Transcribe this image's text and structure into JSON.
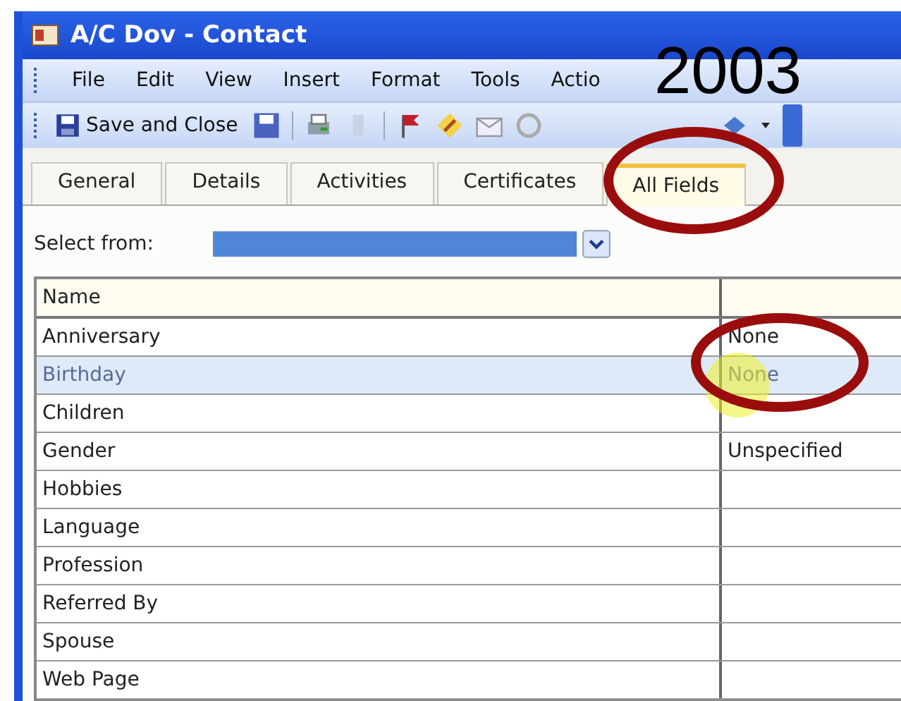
{
  "window": {
    "title": "A/C Dov - Contact"
  },
  "menu": [
    "File",
    "Edit",
    "View",
    "Insert",
    "Format",
    "Tools",
    "Actio"
  ],
  "toolbar": {
    "save_and_close": "Save and Close"
  },
  "tabs": [
    {
      "label": "General",
      "selected": false
    },
    {
      "label": "Details",
      "selected": false
    },
    {
      "label": "Activities",
      "selected": false
    },
    {
      "label": "Certificates",
      "selected": false
    },
    {
      "label": "All Fields",
      "selected": true
    }
  ],
  "select_from": {
    "label": "Select from:"
  },
  "table": {
    "columns": [
      "Name"
    ],
    "rows": [
      {
        "name": "Anniversary",
        "value": "None",
        "selected": false
      },
      {
        "name": "Birthday",
        "value": "None",
        "selected": true
      },
      {
        "name": "Children",
        "selected": false
      },
      {
        "name": "Gender",
        "value": "Unspecified",
        "selected": false
      },
      {
        "name": "Hobbies",
        "selected": false
      },
      {
        "name": "Language",
        "selected": false
      },
      {
        "name": "Profession",
        "selected": false
      },
      {
        "name": "Referred By",
        "selected": false
      },
      {
        "name": "Spouse",
        "selected": false
      },
      {
        "name": "Web Page",
        "selected": false
      }
    ]
  },
  "annotation": {
    "text": "2003"
  }
}
